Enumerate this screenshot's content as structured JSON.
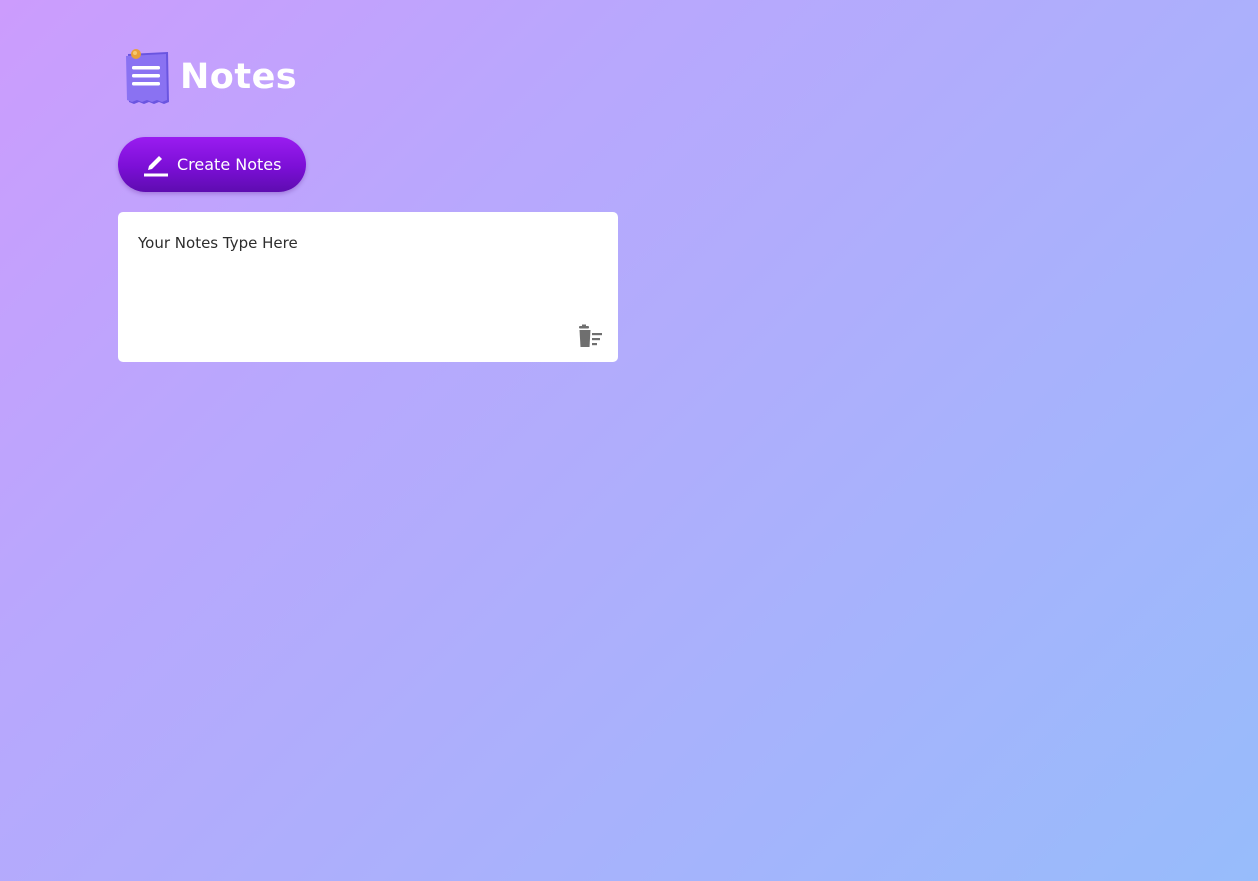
{
  "app": {
    "title": "Notes",
    "logo_icon": "notepad-icon"
  },
  "toolbar": {
    "create_label": "Create Notes",
    "create_icon": "pencil-icon"
  },
  "notes": [
    {
      "text": "Your Notes Type Here",
      "delete_icon": "trash-icon"
    }
  ],
  "colors": {
    "button": "#7b0fd6",
    "background_start": "#cc9cfd",
    "background_end": "#97bcfb",
    "title": "#ffffff"
  }
}
